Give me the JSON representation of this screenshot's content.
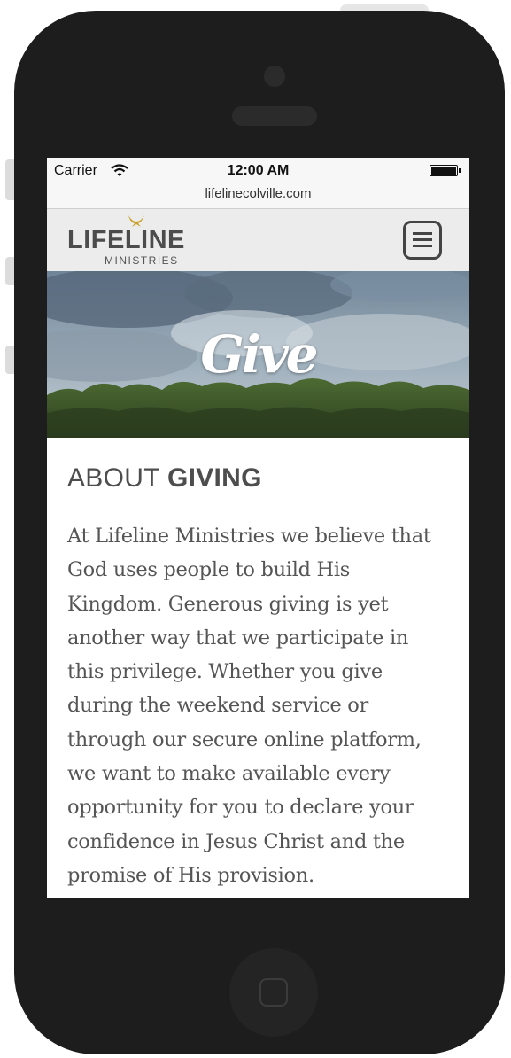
{
  "status_bar": {
    "carrier": "Carrier",
    "time": "12:00 AM",
    "url": "lifelinecolville.com"
  },
  "header": {
    "logo_main": "LIFELINE",
    "logo_sub": "MINISTRIES",
    "logo_icon": "dove-icon",
    "menu_icon": "hamburger-menu-icon"
  },
  "hero": {
    "title": "Give"
  },
  "content": {
    "heading_light": "ABOUT",
    "heading_bold": "GIVING",
    "body": "At Lifeline Ministries we believe that God uses people to build His Kingdom. Generous giving is yet another way that we participate in this privilege. Whether you give during the weekend service or through our secure online platform, we want to make available every opportunity for you to declare your confidence in Jesus Christ and the promise of His provision."
  },
  "colors": {
    "frame": "#1d1d1d",
    "header_bg": "#ececec",
    "logo_accent": "#c9a227",
    "text": "#555555"
  }
}
